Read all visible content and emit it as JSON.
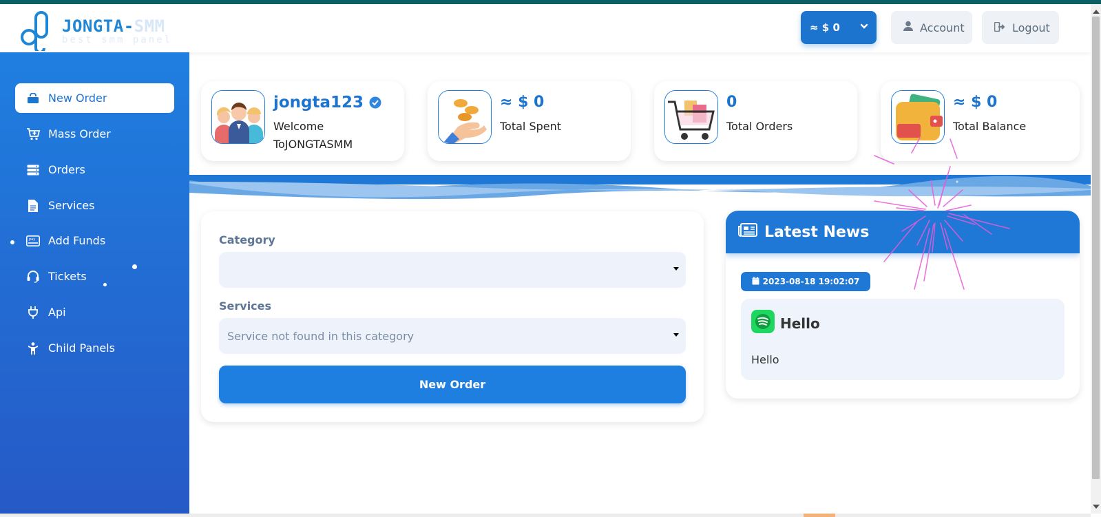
{
  "brand": {
    "name_main": "JONGTA-",
    "name_fade": "SMM",
    "tagline": "best smm panel"
  },
  "header": {
    "balance_label": "≈ $ 0",
    "account_label": "Account",
    "logout_label": "Logout"
  },
  "sidebar": {
    "items": [
      {
        "label": "New Order",
        "icon": "shopping-bag-icon",
        "active": true
      },
      {
        "label": "Mass Order",
        "icon": "cart-plus-icon"
      },
      {
        "label": "Orders",
        "icon": "server-icon"
      },
      {
        "label": "Services",
        "icon": "file-icon"
      },
      {
        "label": "Add Funds",
        "icon": "pay-card-icon"
      },
      {
        "label": "Tickets",
        "icon": "headset-icon"
      },
      {
        "label": "Api",
        "icon": "plug-icon"
      },
      {
        "label": "Child Panels",
        "icon": "child-icon"
      }
    ]
  },
  "stats": {
    "user": {
      "username": "jongta123",
      "welcome_line1": "Welcome",
      "welcome_line2": "ToJONGTASMM"
    },
    "spent": {
      "value": "≈ $ 0",
      "label": "Total Spent"
    },
    "orders": {
      "value": "0",
      "label": "Total Orders"
    },
    "balance": {
      "value": "≈ $ 0",
      "label": "Total Balance"
    }
  },
  "order_form": {
    "category_label": "Category",
    "category_value": "",
    "services_label": "Services",
    "services_value": "Service not found in this category",
    "submit_label": "New Order"
  },
  "news": {
    "heading": "Latest News",
    "items": [
      {
        "date": "2023-08-18 19:02:07",
        "title": "Hello",
        "body": "Hello",
        "icon": "spotify-icon"
      }
    ]
  },
  "colors": {
    "primary": "#1f7fe0",
    "accent_dark": "#1d74cf",
    "topbar": "#0d5f66"
  }
}
